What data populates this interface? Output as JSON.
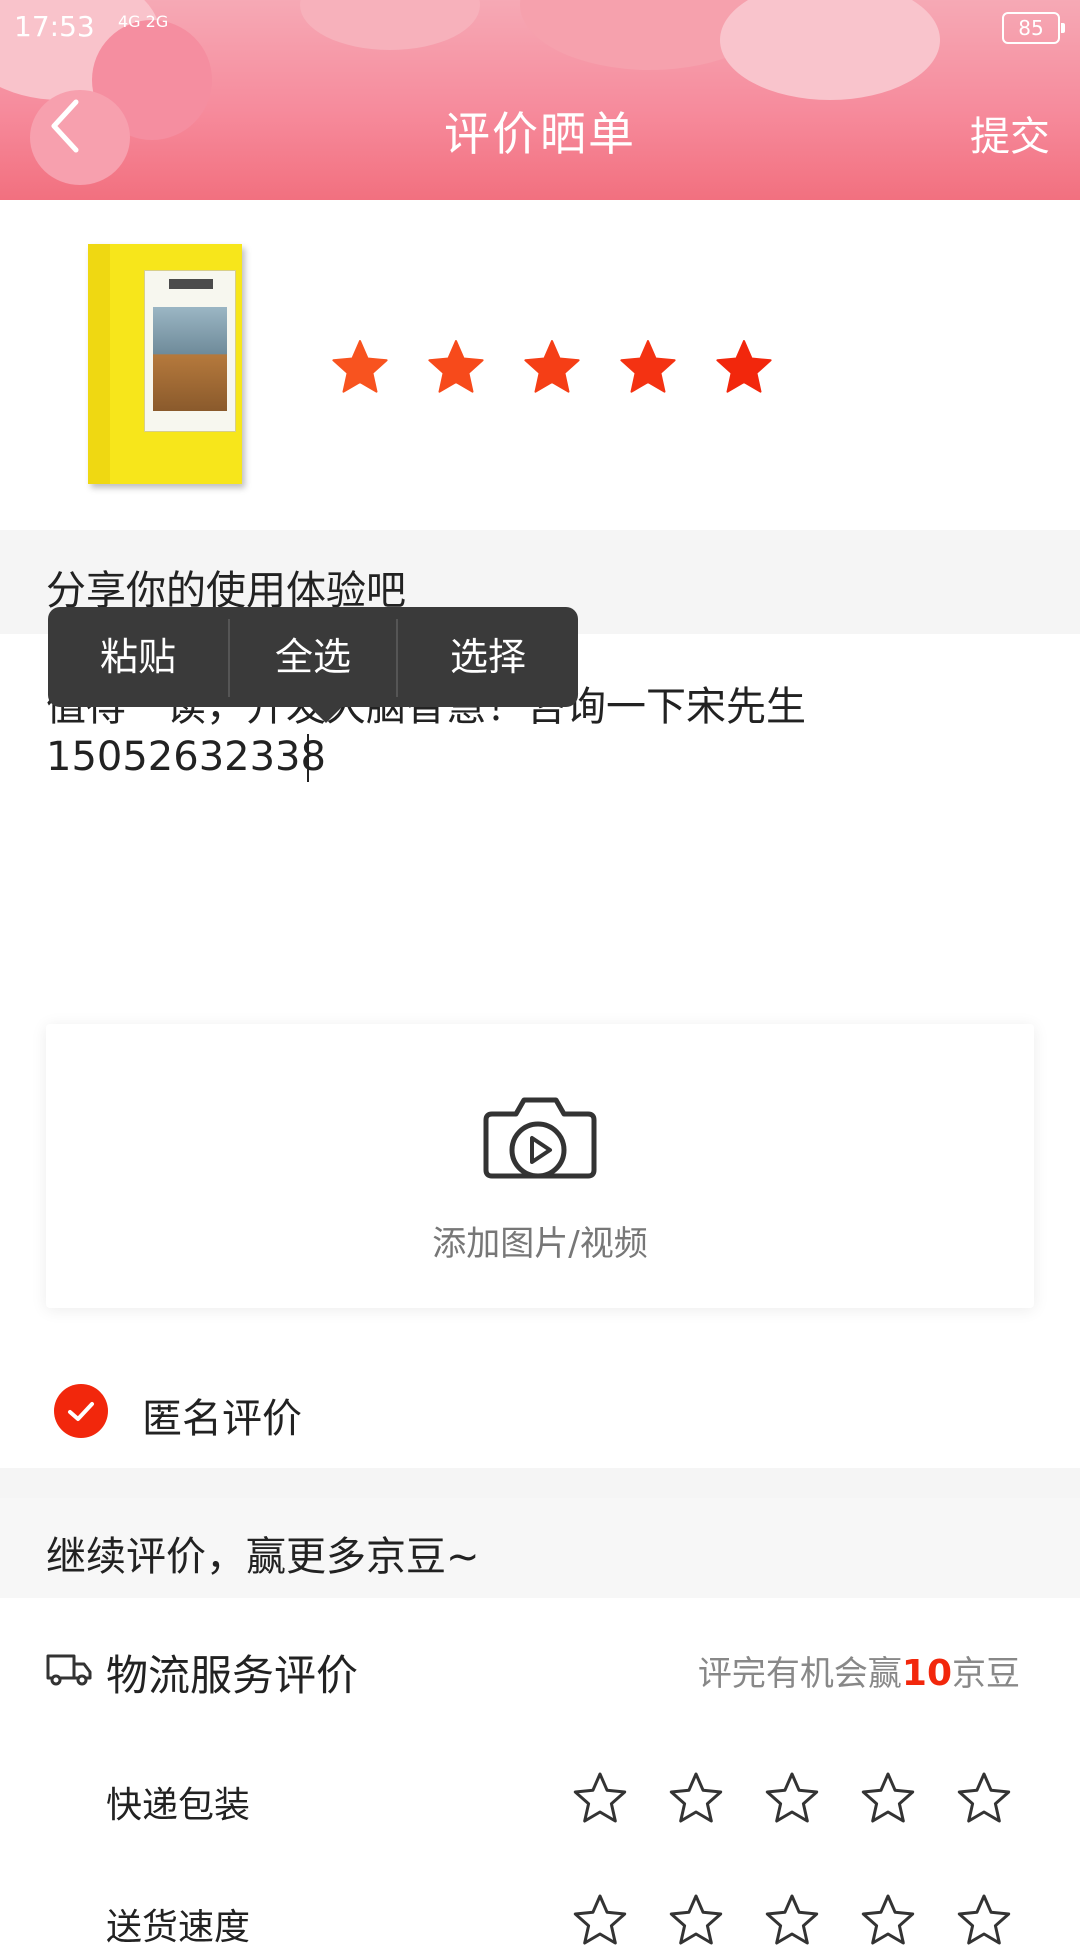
{
  "status_bar": {
    "time": "17:53",
    "network": "4G 2G",
    "battery": "85"
  },
  "header": {
    "title": "评价晒单",
    "submit_label": "提交"
  },
  "product": {
    "rating_stars": 5,
    "star_color": "#f2270c"
  },
  "review": {
    "prompt": "分享你的使用体验吧",
    "text": "值得一读，开发大脑智慧！咨询一下宋先生\n15052632338"
  },
  "context_menu": {
    "items": [
      "粘贴",
      "全选",
      "选择"
    ]
  },
  "upload": {
    "label": "添加图片/视频"
  },
  "anonymous": {
    "label": "匿名评价",
    "checked": true
  },
  "continue_section": {
    "label": "继续评价，赢更多京豆~"
  },
  "logistics": {
    "title": "物流服务评价",
    "note_prefix": "评完有机会赢",
    "note_number": "10",
    "note_suffix": "京豆",
    "rows": [
      {
        "label": "快递包装",
        "stars": 0
      },
      {
        "label": "送货速度",
        "stars": 0
      }
    ]
  }
}
